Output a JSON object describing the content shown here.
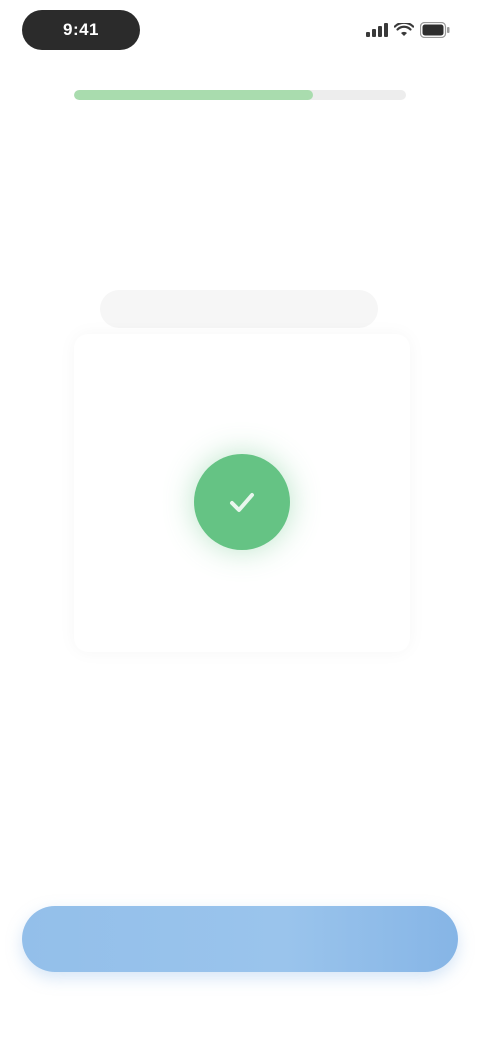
{
  "status_bar": {
    "time": "9:41",
    "icons": [
      "cellular-signal-icon",
      "wifi-icon",
      "battery-icon"
    ]
  },
  "progress": {
    "value": 0.72,
    "color": "#a9dcae"
  },
  "title": {
    "accent_text": "",
    "text": ""
  },
  "subtitle": "",
  "hint_chip": "",
  "card": {
    "icon": "checkmark-icon",
    "icon_color": "#65c384",
    "caption": ""
  },
  "helper_text": "",
  "primary_button": {
    "label": "",
    "color": "#93bfea"
  }
}
